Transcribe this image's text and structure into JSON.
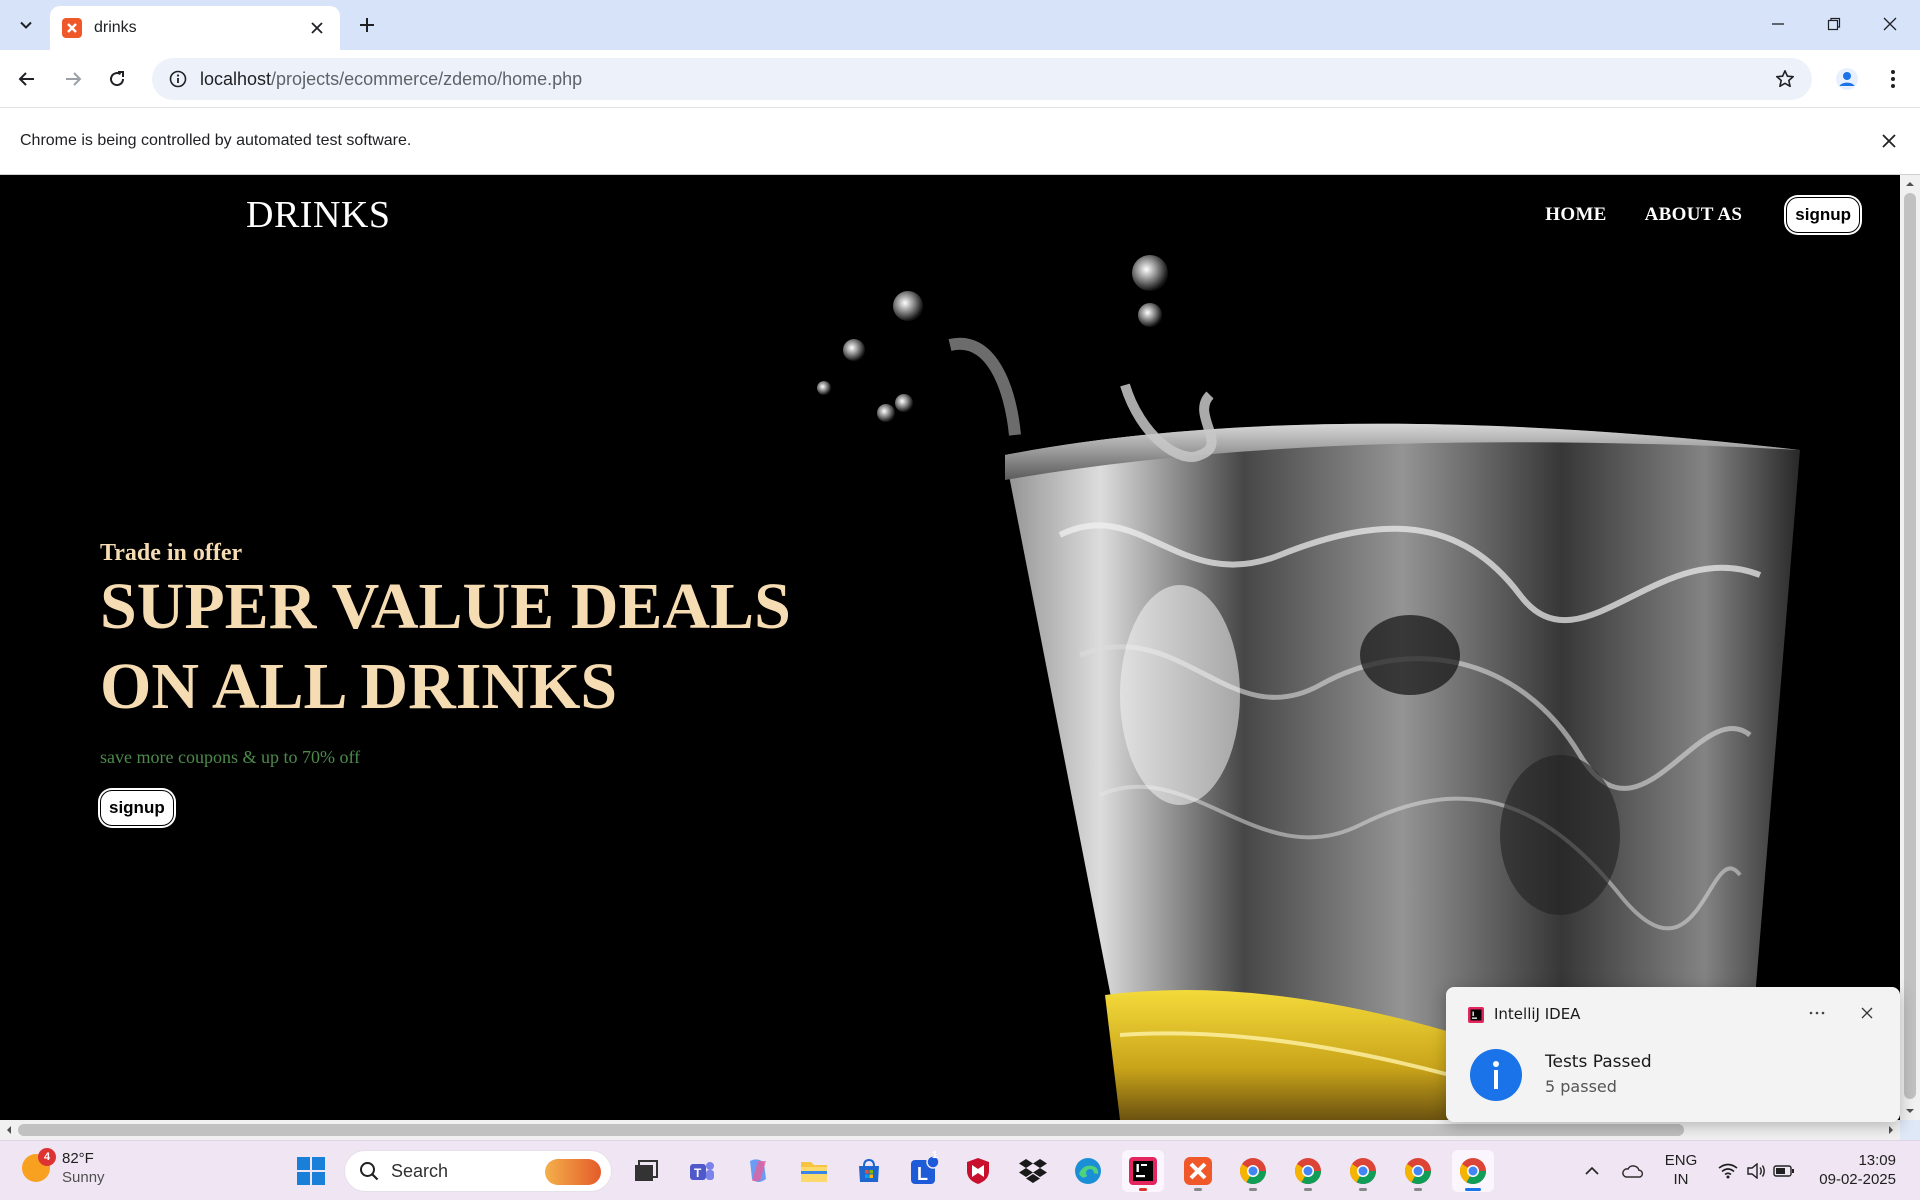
{
  "browser": {
    "tab_title": "drinks",
    "url_host": "localhost",
    "url_path": "/projects/ecommerce/zdemo/home.php",
    "infobar_text": "Chrome is being controlled by automated test software."
  },
  "site": {
    "logo": "DRINKS",
    "nav": [
      "HOME",
      "ABOUT AS"
    ],
    "nav_signup": "signup"
  },
  "hero": {
    "kicker": "Trade in offer",
    "title_line1": "SUPER VALUE DEALS",
    "title_line2": "ON ALL DRINKS",
    "subtitle": "save more coupons & up to 70% off",
    "cta": "signup"
  },
  "notification": {
    "app": "IntelliJ IDEA",
    "title": "Tests Passed",
    "body": "5 passed"
  },
  "taskbar": {
    "weather_temp": "82°F",
    "weather_desc": "Sunny",
    "weather_badge": "4",
    "search_label": "Search",
    "lang_line1": "ENG",
    "lang_line2": "IN",
    "time": "13:09",
    "date": "09-02-2025",
    "lens_badge": "1"
  },
  "colors": {
    "hero_text": "#f6dcb3",
    "hero_subtitle": "#4c8a4a",
    "page_bg": "#000000"
  }
}
